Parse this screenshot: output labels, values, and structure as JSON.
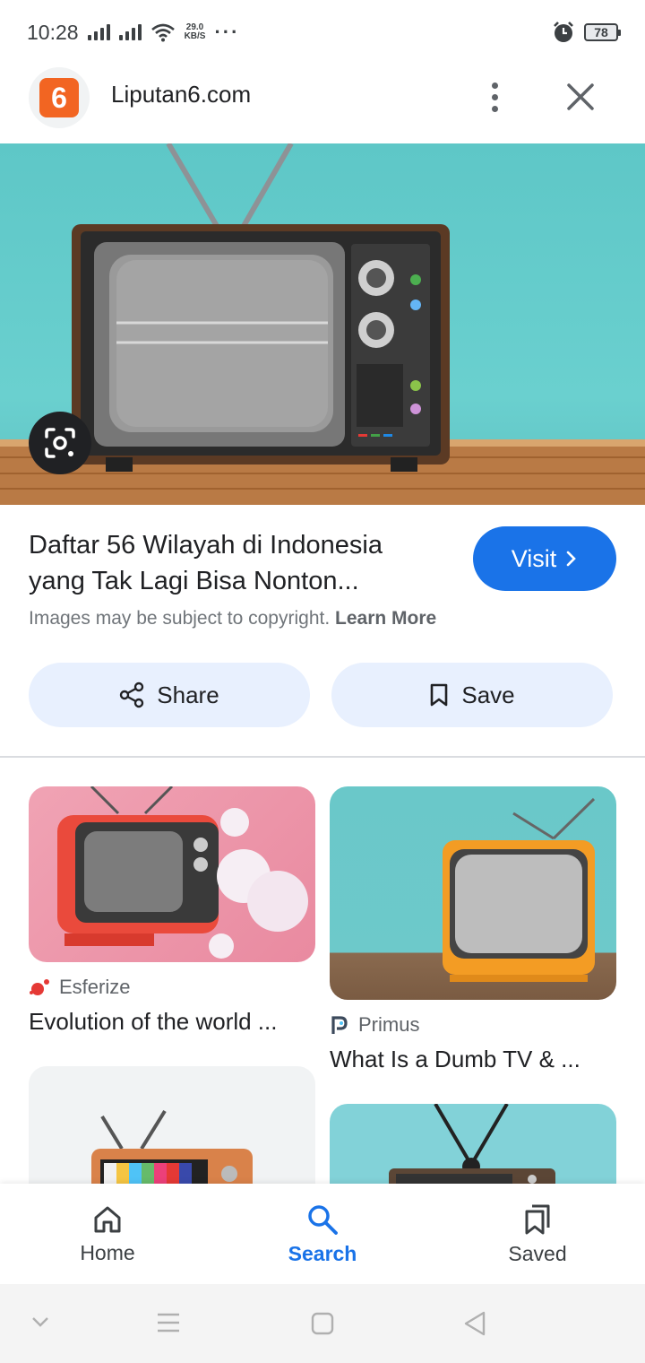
{
  "status_bar": {
    "time": "10:28",
    "net_speed_value": "29.0",
    "net_speed_unit": "KB/S",
    "more": "···",
    "battery": "78"
  },
  "header": {
    "site_logo_text": "6",
    "site_name": "Liputan6.com",
    "brand_color": "#f26522"
  },
  "caption": {
    "title_line1": "Daftar 56 Wilayah di Indonesia",
    "title_line2": "yang Tak Lagi Bisa Nonton...",
    "visit_label": "Visit",
    "copyright_text": "Images may be subject to copyright.",
    "learn_more": "Learn More"
  },
  "actions": {
    "share_label": "Share",
    "save_label": "Save"
  },
  "results": [
    {
      "source": "Esferize",
      "title": "Evolution of the world ..."
    },
    {
      "source": "Primus",
      "title": "What Is a Dumb TV & ..."
    }
  ],
  "bottom_nav": {
    "items": [
      {
        "label": "Home",
        "icon": "home-icon"
      },
      {
        "label": "Search",
        "icon": "search-icon"
      },
      {
        "label": "Saved",
        "icon": "saved-icon"
      }
    ],
    "active": "Search",
    "accent_color": "#1a73e8"
  }
}
